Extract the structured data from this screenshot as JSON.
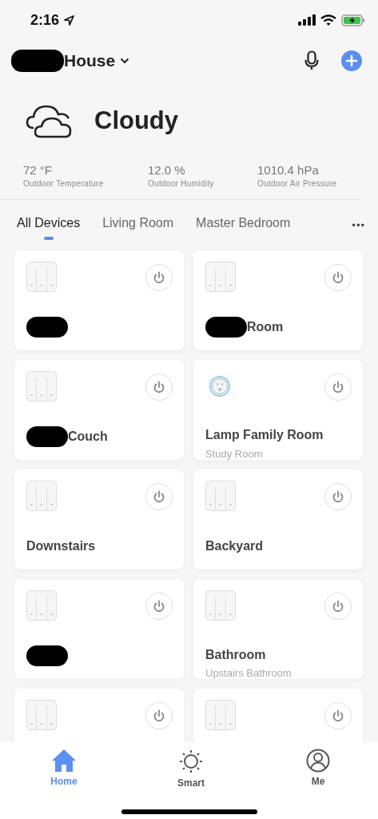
{
  "status_bar": {
    "time": "2:16"
  },
  "header": {
    "home_name": "House",
    "home_name_redacted": true
  },
  "weather": {
    "condition": "Cloudy"
  },
  "stats": [
    {
      "value": "72 °F",
      "label": "Outdoor Temperature"
    },
    {
      "value": "12.0 %",
      "label": "Outdoor Humidity"
    },
    {
      "value": "1010.4 hPa",
      "label": "Outdoor Air Pressure"
    }
  ],
  "tabs": [
    {
      "label": "All Devices",
      "selected": true
    },
    {
      "label": "Living Room",
      "selected": false
    },
    {
      "label": "Master Bedroom",
      "selected": false
    }
  ],
  "more_tabs": "•••",
  "devices": [
    {
      "kind": "switch",
      "redacted": true
    },
    {
      "kind": "switch",
      "redacted": true,
      "name": "Room"
    },
    {
      "kind": "switch",
      "redacted": true,
      "name": "Couch"
    },
    {
      "kind": "plug",
      "redacted": false,
      "name": "Lamp Family Room",
      "room": "Study Room"
    },
    {
      "kind": "switch",
      "redacted": false,
      "name": "Downstairs"
    },
    {
      "kind": "switch",
      "redacted": false,
      "name": "Backyard"
    },
    {
      "kind": "switch",
      "redacted": true
    },
    {
      "kind": "switch",
      "redacted": false,
      "name": "Bathroom",
      "room": "Upstairs Bathroom"
    },
    {
      "kind": "switch",
      "redacted": false
    },
    {
      "kind": "switch",
      "redacted": false
    }
  ],
  "bottom_nav": [
    {
      "label": "Home",
      "kind": "home",
      "selected": true
    },
    {
      "label": "Smart",
      "kind": "smart",
      "selected": false
    },
    {
      "label": "Me",
      "kind": "me",
      "selected": false
    }
  ]
}
